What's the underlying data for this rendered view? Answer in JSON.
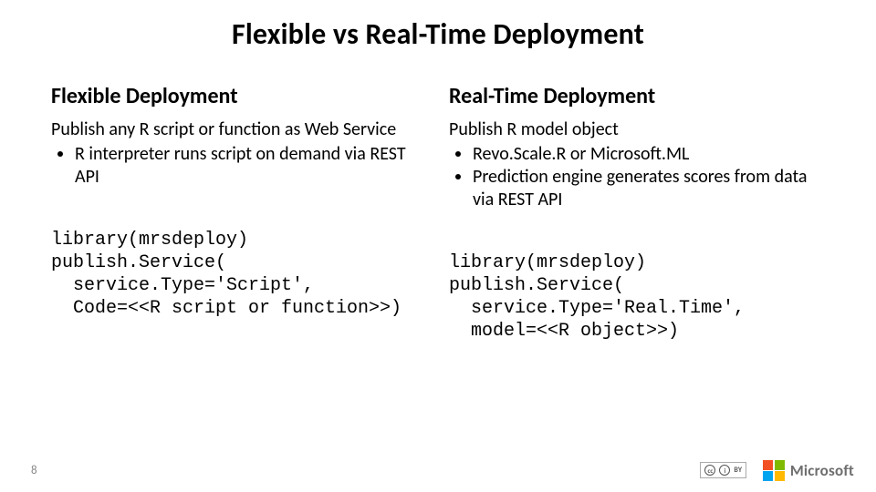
{
  "title": "Flexible vs Real-Time Deployment",
  "left": {
    "heading": "Flexible Deployment",
    "intro": "Publish any R script or function as Web Service",
    "bullet1": "R interpreter runs script on demand via REST API",
    "code1": "library(mrsdeploy)",
    "code2": "publish.Service(",
    "code3": "  service.Type='Script',",
    "code4": "  Code=<<R script or function>>)"
  },
  "right": {
    "heading": "Real-Time Deployment",
    "intro": "Publish R model object",
    "bullet1": "Revo.Scale.R or Microsoft.ML",
    "bullet2": "Prediction engine generates scores from data via REST API",
    "code1": "library(mrsdeploy)",
    "code2": "publish.Service(",
    "code3": "  service.Type='Real.Time',",
    "code4": "  model=<<R object>>)"
  },
  "pagenum": "8",
  "cc_by": "BY",
  "cc_sym1": "cc",
  "cc_sym2": "i",
  "ms": "Microsoft"
}
